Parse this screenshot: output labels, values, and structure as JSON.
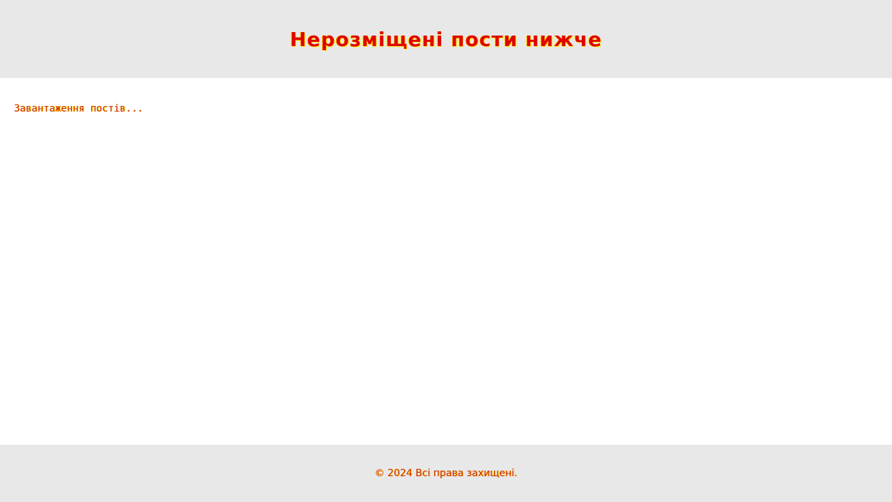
{
  "header": {
    "title": "Нерозміщені пости нижче"
  },
  "main": {
    "loading_text": "Завантаження постів..."
  },
  "footer": {
    "copyright": "© 2024 Всі права захищені."
  },
  "colors": {
    "header_bg": "#e8e8e8",
    "footer_bg": "#e8e8e8",
    "text_primary": "#e00000",
    "text_glow": "#ffee00"
  }
}
